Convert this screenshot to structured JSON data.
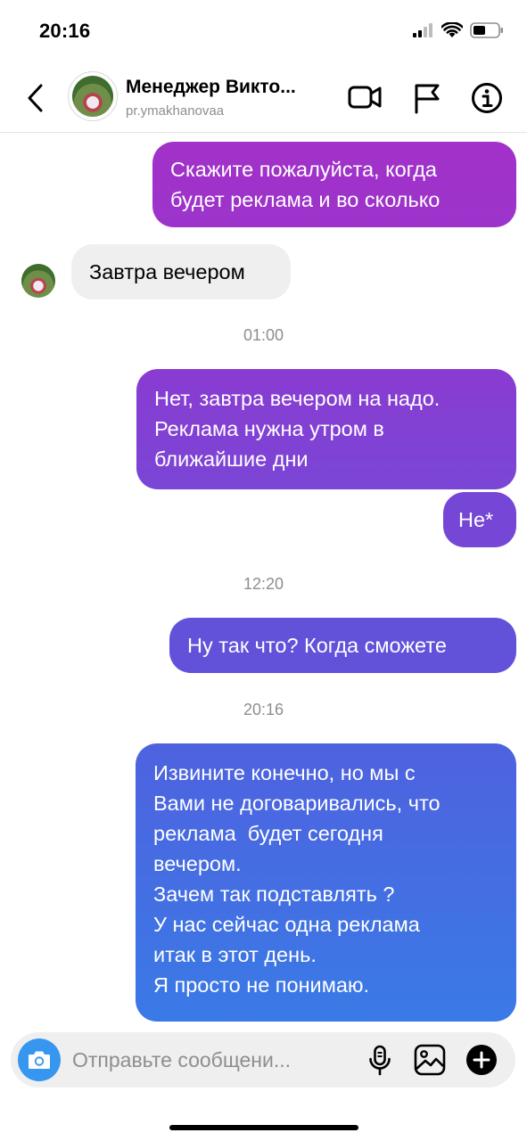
{
  "status_bar": {
    "time": "20:16"
  },
  "header": {
    "title": "Менеджер Викто...",
    "subtitle": "pr.ymakhanovaa"
  },
  "messages": [
    {
      "type": "sent",
      "lines": [
        "Скажите пожалуйста, когда",
        "будет реклама и во сколько"
      ]
    },
    {
      "type": "received",
      "lines": [
        "Завтра вечером"
      ]
    },
    {
      "type": "timestamp",
      "text": "01:00"
    },
    {
      "type": "sent",
      "lines": [
        "Нет, завтра вечером на надо.",
        "Реклама нужна утром в",
        "ближайшие дни"
      ]
    },
    {
      "type": "sent",
      "lines": [
        "Не*"
      ]
    },
    {
      "type": "timestamp",
      "text": "12:20"
    },
    {
      "type": "sent",
      "lines": [
        "Ну так что? Когда сможете"
      ]
    },
    {
      "type": "timestamp",
      "text": "20:16"
    },
    {
      "type": "sent",
      "lines": [
        "Извините конечно, но мы с",
        "Вами не договаривались, что",
        "реклама  будет сегодня",
        "вечером.",
        "Зачем так подставлять ?",
        "У нас сейчас одна реклама",
        "итак в этот день.",
        "Я просто не понимаю."
      ]
    }
  ],
  "composer": {
    "placeholder": "Отправьте сообщени..."
  },
  "colors": {
    "accent": "#3797f0",
    "sent_top": "#a030c8",
    "sent_bottom": "#3b7ae6",
    "received_bg": "#efefef"
  },
  "icons": [
    "back-icon",
    "video-call-icon",
    "flag-icon",
    "info-icon",
    "camera-icon",
    "microphone-icon",
    "gallery-icon",
    "add-icon"
  ]
}
